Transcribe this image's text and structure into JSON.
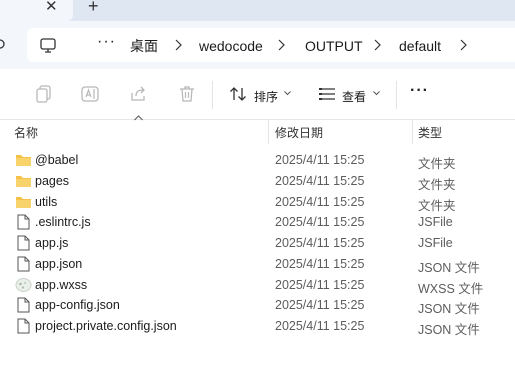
{
  "tabs": {
    "close_glyph": "✕",
    "add_glyph": "+"
  },
  "addressbar": {
    "more_glyph": "···",
    "crumbs": [
      "桌面",
      "wedocode",
      "OUTPUT",
      "default"
    ]
  },
  "toolbar": {
    "sort_label": "排序",
    "view_label": "查看",
    "more_glyph": "···"
  },
  "columns": {
    "name": "名称",
    "date": "修改日期",
    "type": "类型"
  },
  "files": [
    {
      "icon": "folder-icon",
      "name": "@babel",
      "date": "2025/4/11 15:25",
      "type": "文件夹"
    },
    {
      "icon": "folder-icon",
      "name": "pages",
      "date": "2025/4/11 15:25",
      "type": "文件夹"
    },
    {
      "icon": "folder-icon",
      "name": "utils",
      "date": "2025/4/11 15:25",
      "type": "文件夹"
    },
    {
      "icon": "file-icon",
      "name": ".eslintrc.js",
      "date": "2025/4/11 15:25",
      "type": "JSFile"
    },
    {
      "icon": "file-icon",
      "name": "app.js",
      "date": "2025/4/11 15:25",
      "type": "JSFile"
    },
    {
      "icon": "file-icon",
      "name": "app.json",
      "date": "2025/4/11 15:25",
      "type": "JSON 文件"
    },
    {
      "icon": "wxss-file-icon",
      "name": "app.wxss",
      "date": "2025/4/11 15:25",
      "type": "WXSS 文件"
    },
    {
      "icon": "file-icon",
      "name": "app-config.json",
      "date": "2025/4/11 15:25",
      "type": "JSON 文件"
    },
    {
      "icon": "file-icon",
      "name": "project.private.config.json",
      "date": "2025/4/11 15:25",
      "type": "JSON 文件"
    }
  ],
  "colors": {
    "folder": "#f4c247",
    "tab_strip": "#dfe7f3",
    "chrome": "#f3f6fb"
  }
}
